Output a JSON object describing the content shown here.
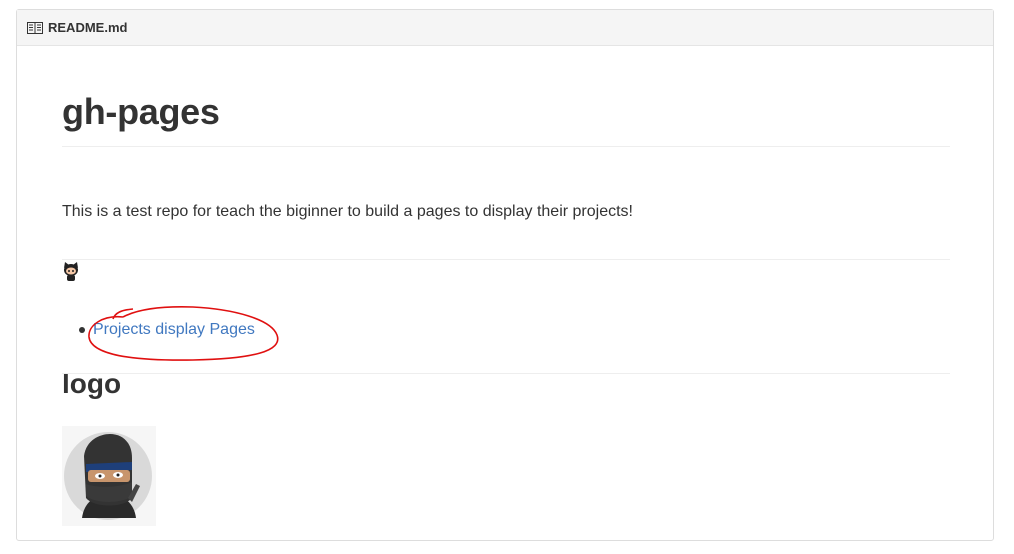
{
  "header": {
    "title": "README.md",
    "icon": "book-icon"
  },
  "readme": {
    "heading": "gh-pages",
    "intro": "This is a test repo for teach the biginner to build a pages to display their projects!",
    "octocat_icon": "octocat-icon",
    "links": [
      {
        "label": "Projects display Pages"
      }
    ],
    "logo_heading": "logo",
    "logo_image": "ninja-avatar"
  },
  "colors": {
    "link": "#4078c0",
    "annotation": "#e01010",
    "text": "#333333"
  }
}
